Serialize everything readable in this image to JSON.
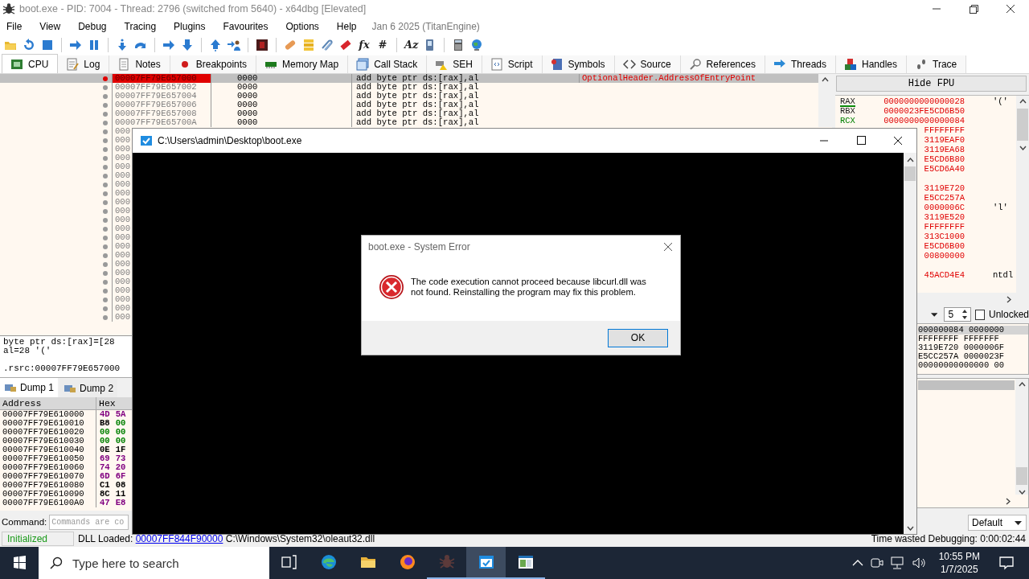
{
  "window": {
    "title": "boot.exe - PID: 7004 - Thread: 2796 (switched from 5640) - x64dbg [Elevated]"
  },
  "menu": [
    "File",
    "View",
    "Debug",
    "Tracing",
    "Plugins",
    "Favourites",
    "Options",
    "Help"
  ],
  "build_info": "Jan 6 2025 (TitanEngine)",
  "toolbar": [
    {
      "kind": "folder"
    },
    {
      "kind": "restart"
    },
    {
      "kind": "stop"
    },
    {
      "kind": "separator"
    },
    {
      "kind": "run"
    },
    {
      "kind": "pause"
    },
    {
      "kind": "separator"
    },
    {
      "kind": "step-into"
    },
    {
      "kind": "step-over"
    },
    {
      "kind": "separator"
    },
    {
      "kind": "run"
    },
    {
      "kind": "step-down"
    },
    {
      "kind": "separator"
    },
    {
      "kind": "step-up"
    },
    {
      "kind": "user-arrow"
    },
    {
      "kind": "separator"
    },
    {
      "kind": "script"
    },
    {
      "kind": "separator"
    },
    {
      "kind": "bandage"
    },
    {
      "kind": "stack"
    },
    {
      "kind": "clips"
    },
    {
      "kind": "tag"
    },
    {
      "kind": "glyph",
      "text": "fx"
    },
    {
      "kind": "glyph",
      "text": "#"
    },
    {
      "kind": "separator"
    },
    {
      "kind": "glyph",
      "text": "Az"
    },
    {
      "kind": "device"
    },
    {
      "kind": "separator"
    },
    {
      "kind": "calculator"
    },
    {
      "kind": "globe"
    }
  ],
  "tabs": [
    {
      "label": "CPU",
      "selected": true
    },
    {
      "label": "Log",
      "selected": false
    },
    {
      "label": "Notes",
      "selected": false
    },
    {
      "label": "Breakpoints",
      "selected": false
    },
    {
      "label": "Memory Map",
      "selected": false
    },
    {
      "label": "Call Stack",
      "selected": false
    },
    {
      "label": "SEH",
      "selected": false
    },
    {
      "label": "Script",
      "selected": false
    },
    {
      "label": "Symbols",
      "selected": false
    },
    {
      "label": "Source",
      "selected": false
    },
    {
      "label": "References",
      "selected": false
    },
    {
      "label": "Threads",
      "selected": false
    },
    {
      "label": "Handles",
      "selected": false
    },
    {
      "label": "Trace",
      "selected": false
    }
  ],
  "disassembly": {
    "rows": [
      {
        "address": "00007FF79E657000",
        "bytes": "0000",
        "instruction": "add byte ptr ds:[rax],al",
        "comment": "OptionalHeader.AddressOfEntryPoint",
        "selected": true,
        "breakpoint": true
      },
      {
        "address": "00007FF79E657002",
        "bytes": "0000",
        "instruction": "add byte ptr ds:[rax],al",
        "selected": false,
        "breakpoint": false
      },
      {
        "address": "00007FF79E657004",
        "bytes": "0000",
        "instruction": "add byte ptr ds:[rax],al",
        "selected": false,
        "breakpoint": false
      },
      {
        "address": "00007FF79E657006",
        "bytes": "0000",
        "instruction": "add byte ptr ds:[rax],al",
        "selected": false,
        "breakpoint": false
      },
      {
        "address": "00007FF79E657008",
        "bytes": "0000",
        "instruction": "add byte ptr ds:[rax],al",
        "selected": false,
        "breakpoint": false
      },
      {
        "address": "00007FF79E65700A",
        "bytes": "0000",
        "instruction": "add byte ptr ds:[rax],al",
        "selected": false,
        "breakpoint": false
      },
      {
        "address": "000",
        "selected": false,
        "breakpoint": false
      },
      {
        "address": "000",
        "selected": false,
        "breakpoint": false
      },
      {
        "address": "000",
        "selected": false,
        "breakpoint": false
      },
      {
        "address": "000",
        "selected": false,
        "breakpoint": false
      },
      {
        "address": "000",
        "selected": false,
        "breakpoint": false
      },
      {
        "address": "000",
        "selected": false,
        "breakpoint": false
      },
      {
        "address": "000",
        "selected": false,
        "breakpoint": false
      },
      {
        "address": "000",
        "selected": false,
        "breakpoint": false
      },
      {
        "address": "000",
        "selected": false,
        "breakpoint": false
      },
      {
        "address": "000",
        "selected": false,
        "breakpoint": false
      },
      {
        "address": "000",
        "selected": false,
        "breakpoint": false
      },
      {
        "address": "000",
        "selected": false,
        "breakpoint": false
      },
      {
        "address": "000",
        "selected": false,
        "breakpoint": false
      },
      {
        "address": "000",
        "selected": false,
        "breakpoint": false
      },
      {
        "address": "000",
        "selected": false,
        "breakpoint": false
      },
      {
        "address": "000",
        "selected": false,
        "breakpoint": false
      },
      {
        "address": "000",
        "selected": false,
        "breakpoint": false
      },
      {
        "address": "000",
        "selected": false,
        "breakpoint": false
      },
      {
        "address": "000",
        "selected": false,
        "breakpoint": false
      },
      {
        "address": "000",
        "selected": false,
        "breakpoint": false
      },
      {
        "address": "000",
        "selected": false,
        "breakpoint": false
      },
      {
        "address": "000",
        "selected": false,
        "breakpoint": false
      }
    ]
  },
  "info": {
    "lines": [
      "byte ptr ds:[rax]=[28",
      "al=28 '('"
    ],
    "location": ".rsrc:00007FF79E657000"
  },
  "dump_tabs": [
    {
      "label": "Dump 1",
      "selected": true
    },
    {
      "label": "Dump 2",
      "selected": false
    }
  ],
  "dump": {
    "columns": [
      "Address",
      "Hex"
    ],
    "rows": [
      {
        "address": "00007FF79E610000",
        "hex": [
          {
            "text": "4D",
            "color": "#800080"
          },
          {
            "text": "5A",
            "color": "#800080"
          }
        ]
      },
      {
        "address": "00007FF79E610010",
        "hex": [
          {
            "text": "B8",
            "color": "#000000"
          },
          {
            "text": "00",
            "color": "#008000"
          }
        ]
      },
      {
        "address": "00007FF79E610020",
        "hex": [
          {
            "text": "00",
            "color": "#008000"
          },
          {
            "text": "00",
            "color": "#008000"
          }
        ]
      },
      {
        "address": "00007FF79E610030",
        "hex": [
          {
            "text": "00",
            "color": "#008000"
          },
          {
            "text": "00",
            "color": "#008000"
          }
        ]
      },
      {
        "address": "00007FF79E610040",
        "hex": [
          {
            "text": "0E",
            "color": "#000000"
          },
          {
            "text": "1F",
            "color": "#000000"
          }
        ]
      },
      {
        "address": "00007FF79E610050",
        "hex": [
          {
            "text": "69",
            "color": "#800080"
          },
          {
            "text": "73",
            "color": "#800080"
          }
        ]
      },
      {
        "address": "00007FF79E610060",
        "hex": [
          {
            "text": "74",
            "color": "#800080"
          },
          {
            "text": "20",
            "color": "#800080"
          }
        ]
      },
      {
        "address": "00007FF79E610070",
        "hex": [
          {
            "text": "6D",
            "color": "#800080"
          },
          {
            "text": "6F",
            "color": "#800080"
          }
        ]
      },
      {
        "address": "00007FF79E610080",
        "hex": [
          {
            "text": "C1",
            "color": "#000000"
          },
          {
            "text": "08",
            "color": "#000000"
          }
        ]
      },
      {
        "address": "00007FF79E610090",
        "hex": [
          {
            "text": "8C",
            "color": "#000000"
          },
          {
            "text": "11",
            "color": "#000000"
          }
        ]
      },
      {
        "address": "00007FF79E6100A0",
        "hex": [
          {
            "text": "47",
            "color": "#800080"
          },
          {
            "text": "E8",
            "color": "#800080"
          }
        ]
      }
    ]
  },
  "command": {
    "label": "Command:",
    "placeholder": "Commands are co",
    "mode": "Default"
  },
  "registers": {
    "button": "Hide FPU",
    "rows": [
      {
        "kind": "register",
        "name": "RAX",
        "color": "#1a1a1a",
        "underlined": true,
        "value": "0000000000000028",
        "comment": "'('"
      },
      {
        "kind": "register",
        "name": "RBX",
        "color": "#1a1a1a",
        "underlined": false,
        "value": "0000023FE5CD6B50"
      },
      {
        "kind": "register",
        "name": "RCX",
        "color": "#008000",
        "underlined": false,
        "value": "0000000000000084"
      },
      {
        "kind": "register",
        "value": "FFFFFFFF"
      },
      {
        "kind": "register",
        "value": "3119EAF0"
      },
      {
        "kind": "register",
        "value": "3119EA68"
      },
      {
        "kind": "register",
        "value": "E5CD6B80"
      },
      {
        "kind": "register",
        "value": "E5CD6A40"
      },
      {
        "kind": "spacer"
      },
      {
        "kind": "register",
        "value": "3119E720"
      },
      {
        "kind": "register",
        "value": "E5CC257A"
      },
      {
        "kind": "register",
        "value": "0000006C",
        "comment": "'l'"
      },
      {
        "kind": "register",
        "value": "3119E520"
      },
      {
        "kind": "register",
        "value": "FFFFFFFF"
      },
      {
        "kind": "register",
        "value": "313C1000"
      },
      {
        "kind": "register",
        "value": "E5CD6B00"
      },
      {
        "kind": "register",
        "value": "00800000"
      },
      {
        "kind": "spacer"
      },
      {
        "kind": "register",
        "value": "45ACD4E4",
        "comment": "ntdl"
      }
    ]
  },
  "stack_controls": {
    "count": "5",
    "lock_label": "Unlocked",
    "locked": false
  },
  "stack_args": [
    {
      "text": "000000084 0000000",
      "selected": true
    },
    {
      "text": "FFFFFFFF FFFFFFF",
      "selected": false
    },
    {
      "text": "3119E720 0000006F",
      "selected": false
    },
    {
      "text": "E5CC257A 0000023F",
      "selected": false
    },
    {
      "text": "00000000000000 00",
      "selected": false
    }
  ],
  "status": {
    "state": "Initialized",
    "prefix": "DLL Loaded:",
    "link": "00007FF844F90000",
    "path": "C:\\Windows\\System32\\oleaut32.dll",
    "timer": "Time wasted Debugging: 0:00:02:44"
  },
  "console": {
    "title": "C:\\Users\\admin\\Desktop\\boot.exe"
  },
  "dialog": {
    "title": "boot.exe - System Error",
    "message": "The code execution cannot proceed because libcurl.dll was not found. Reinstalling the program may fix this problem.",
    "buttons": [
      "OK"
    ]
  },
  "taskbar": {
    "search_placeholder": "Type here to search",
    "apps": [
      {
        "kind": "task-view",
        "running": false,
        "selected": false
      },
      {
        "kind": "edge",
        "running": false,
        "selected": false
      },
      {
        "kind": "explorer",
        "running": false,
        "selected": false
      },
      {
        "kind": "firefox",
        "running": false,
        "selected": false
      },
      {
        "kind": "debugger",
        "running": true,
        "selected": false
      },
      {
        "kind": "console",
        "running": true,
        "selected": true
      },
      {
        "kind": "window",
        "running": true,
        "selected": false
      }
    ],
    "time": "10:55 PM",
    "date": "1/7/2025"
  }
}
